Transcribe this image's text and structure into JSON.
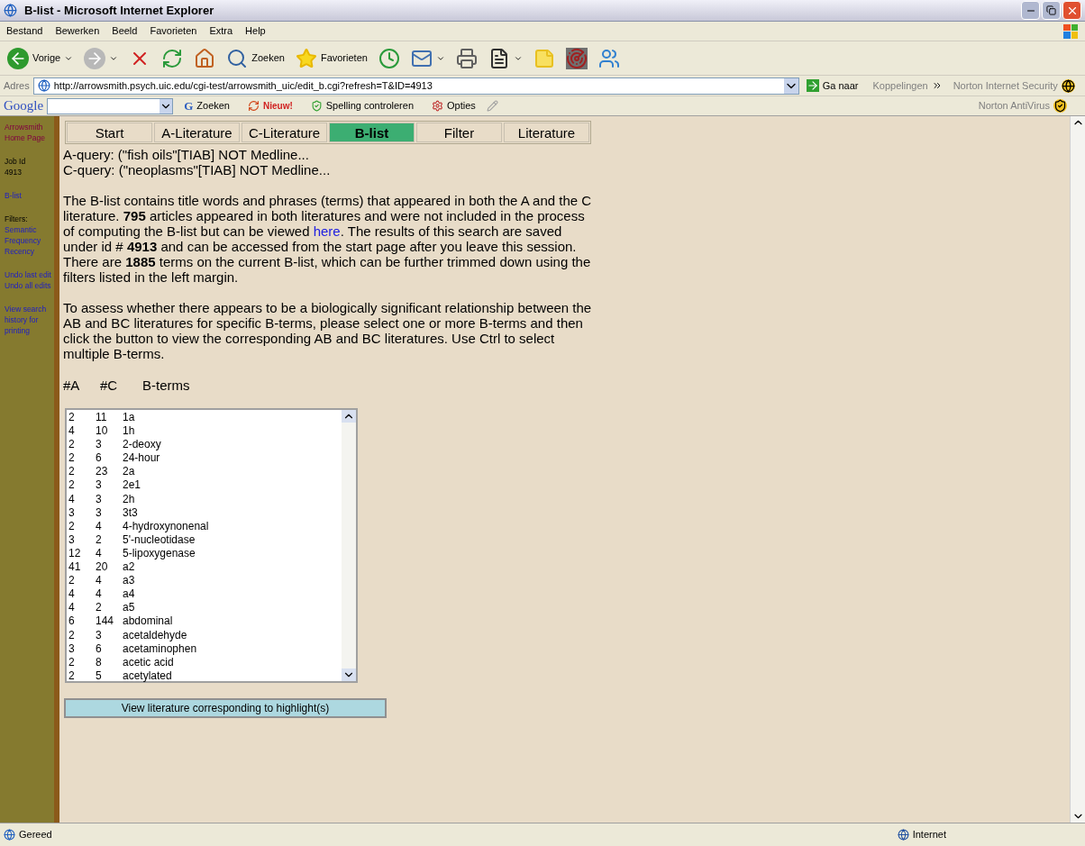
{
  "window": {
    "title": "B-list - Microsoft Internet Explorer"
  },
  "menu": [
    "Bestand",
    "Bewerken",
    "Beeld",
    "Favorieten",
    "Extra",
    "Help"
  ],
  "toolbar": [
    {
      "kind": "back",
      "label": "Vorige"
    },
    {
      "kind": "forward"
    },
    {
      "kind": "stop"
    },
    {
      "kind": "refresh"
    },
    {
      "kind": "home"
    },
    {
      "kind": "search",
      "label": "Zoeken"
    },
    {
      "kind": "favorites",
      "label": "Favorieten"
    },
    {
      "kind": "history"
    },
    {
      "kind": "mail"
    },
    {
      "kind": "print"
    },
    {
      "kind": "edit"
    },
    {
      "kind": "note"
    },
    {
      "kind": "tool"
    },
    {
      "kind": "messenger"
    }
  ],
  "address": {
    "label": "Adres",
    "url": "http://arrowsmith.psych.uic.edu/cgi-test/arrowsmith_uic/edit_b.cgi?refresh=T&ID=4913",
    "go": "Ga naar",
    "links": "Koppelingen",
    "norton": "Norton Internet Security"
  },
  "google_bar": {
    "logo": "Google",
    "g_mark": "G",
    "search": "Zoeken",
    "new": "Nieuw!",
    "spell": "Spelling controleren",
    "options": "Opties",
    "antivirus": "Norton AntiVirus"
  },
  "sidebar": [
    [
      {
        "kind": "visited",
        "text": "Arrowsmith Home Page"
      }
    ],
    [
      {
        "kind": "text",
        "text": "Job Id"
      },
      {
        "kind": "text",
        "text": "4913"
      }
    ],
    [
      {
        "kind": "link",
        "text": "B-list"
      }
    ],
    [
      {
        "kind": "text",
        "text": "Filters:"
      },
      {
        "kind": "link",
        "text": "Semantic"
      },
      {
        "kind": "link",
        "text": "Frequency"
      },
      {
        "kind": "link",
        "text": "Recency"
      }
    ],
    [
      {
        "kind": "link",
        "text": "Undo last edit"
      },
      {
        "kind": "link",
        "text": "Undo all edits"
      }
    ],
    [
      {
        "kind": "link",
        "text": "View search history for printing"
      }
    ]
  ],
  "tabs": [
    {
      "label": "Start",
      "selected": false
    },
    {
      "label": "A-Literature",
      "selected": false
    },
    {
      "label": "C-Literature",
      "selected": false
    },
    {
      "label": "B-list",
      "selected": true
    },
    {
      "label": "Filter",
      "selected": false
    },
    {
      "label": "Literature",
      "selected": false
    }
  ],
  "queries": [
    "A-query: (\"fish oils\"[TIAB] NOT Medline...",
    "C-query: (\"neoplasms\"[TIAB] NOT Medline..."
  ],
  "paragraph_1": {
    "before": "The B-list contains title words and phrases (terms) that appeared in both the A and the C literature. **795** articles appeared in both literatures and were not included in the process of computing the B-list but can be viewed",
    "link": "here",
    "after": ". The results of this search are saved under id # **4913** and can be accessed from the start page after you leave this session. There are **1885** terms on the current B-list, which can be further trimmed down using the filters listed in the left margin."
  },
  "paragraph_2": "To assess whether there appears to be a biologically significant relationship between the AB and BC literatures for specific B-terms, please select one or more B-terms and then click the button to view the corresponding AB and BC literatures. Use Ctrl to select multiple B-terms.",
  "columns": [
    "#A",
    "#C",
    "B-terms"
  ],
  "rows": [
    {
      "a": "2",
      "c": "11",
      "term": "1a",
      "selected": false
    },
    {
      "a": "4",
      "c": "10",
      "term": "1h",
      "selected": false
    },
    {
      "a": "2",
      "c": "3",
      "term": "2-deoxy",
      "selected": false
    },
    {
      "a": "2",
      "c": "6",
      "term": "24-hour",
      "selected": false
    },
    {
      "a": "2",
      "c": "23",
      "term": "2a",
      "selected": false
    },
    {
      "a": "2",
      "c": "3",
      "term": "2e1",
      "selected": false
    },
    {
      "a": "4",
      "c": "3",
      "term": "2h",
      "selected": false
    },
    {
      "a": "3",
      "c": "3",
      "term": "3t3",
      "selected": false
    },
    {
      "a": "2",
      "c": "4",
      "term": "4-hydroxynonenal",
      "selected": false
    },
    {
      "a": "3",
      "c": "2",
      "term": "5'-nucleotidase",
      "selected": false
    },
    {
      "a": "12",
      "c": "4",
      "term": "5-lipoxygenase",
      "selected": false
    },
    {
      "a": "41",
      "c": "20",
      "term": "a2",
      "selected": false
    },
    {
      "a": "2",
      "c": "4",
      "term": "a3",
      "selected": false
    },
    {
      "a": "4",
      "c": "4",
      "term": "a4",
      "selected": false
    },
    {
      "a": "4",
      "c": "2",
      "term": "a5",
      "selected": false
    },
    {
      "a": "6",
      "c": "144",
      "term": "abdominal",
      "selected": false
    },
    {
      "a": "2",
      "c": "3",
      "term": "acetaldehyde",
      "selected": false
    },
    {
      "a": "3",
      "c": "6",
      "term": "acetaminophen",
      "selected": false
    },
    {
      "a": "2",
      "c": "8",
      "term": "acetic acid",
      "selected": false
    },
    {
      "a": "2",
      "c": "5",
      "term": "acetylated",
      "selected": false
    }
  ],
  "view_button": "View literature corresponding to highlight(s)",
  "status_bar": {
    "text": "Gereed",
    "zone": "Internet"
  }
}
